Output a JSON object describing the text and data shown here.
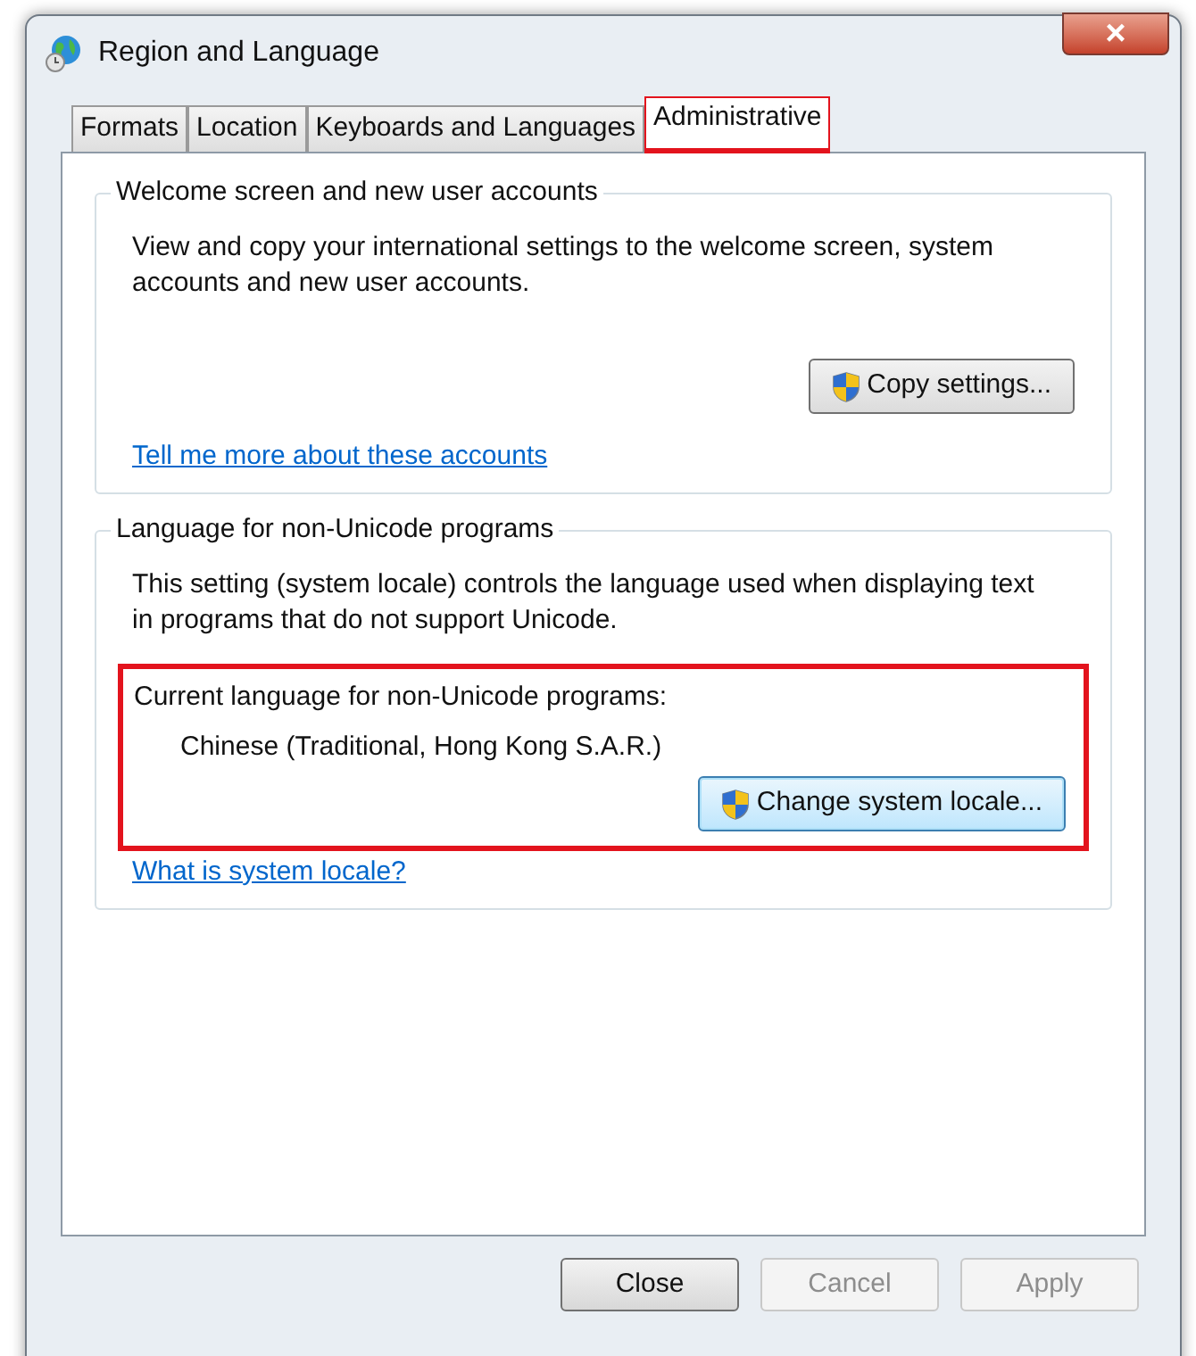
{
  "window": {
    "title": "Region and Language",
    "close": "×"
  },
  "tabs": [
    {
      "label": "Formats",
      "selected": false,
      "highlighted": false
    },
    {
      "label": "Location",
      "selected": false,
      "highlighted": false
    },
    {
      "label": "Keyboards and Languages",
      "selected": false,
      "highlighted": false
    },
    {
      "label": "Administrative",
      "selected": true,
      "highlighted": true
    }
  ],
  "groups": [
    {
      "title": "Welcome screen and new user accounts",
      "description": "View and copy your international settings to the welcome screen, system accounts and new user accounts.",
      "button": {
        "label": "Copy settings...",
        "default": false
      },
      "link": "Tell me more about these accounts"
    },
    {
      "title": "Language for non-Unicode programs",
      "description": "This setting (system locale) controls the language used when displaying text in programs that do not support Unicode.",
      "current": {
        "label": "Current language for non-Unicode programs:",
        "value": "Chinese (Traditional, Hong Kong S.A.R.)",
        "highlighted": true
      },
      "button": {
        "label": "Change system locale...",
        "default": true
      },
      "link": "What is system locale?"
    }
  ],
  "buttons": [
    {
      "label": "Close",
      "disabled": false
    },
    {
      "label": "Cancel",
      "disabled": true
    },
    {
      "label": "Apply",
      "disabled": true
    }
  ]
}
